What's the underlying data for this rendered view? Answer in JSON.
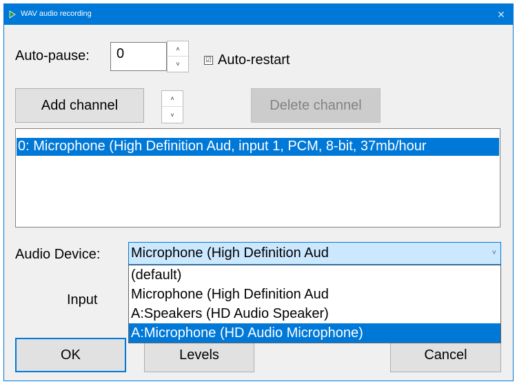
{
  "window": {
    "title": "WAV audio recording",
    "close_glyph": "✕"
  },
  "autopause": {
    "label": "Auto-pause:",
    "value": "0"
  },
  "autorestart": {
    "label": "Auto-restart",
    "checked": true
  },
  "spinner": {
    "up": "˄",
    "down": "˅"
  },
  "channels": {
    "add_label": "Add channel",
    "delete_label": "Delete channel",
    "items": [
      "0: Microphone (High Definition Aud, input 1, PCM, 8-bit, 37mb/hour"
    ]
  },
  "audio_device": {
    "label": "Audio Device:",
    "selected": "Microphone (High Definition Aud",
    "options": [
      "(default)",
      "Microphone (High Definition Aud",
      "A:Speakers (HD Audio Speaker)",
      "A:Microphone (HD Audio Microphone)"
    ],
    "highlighted_index": 3
  },
  "input_label": "Input",
  "buttons": {
    "ok": "OK",
    "levels": "Levels",
    "cancel": "Cancel"
  },
  "colors": {
    "accent": "#0078d7",
    "selection": "#0078d7",
    "combo_bg": "#cce8ff"
  }
}
